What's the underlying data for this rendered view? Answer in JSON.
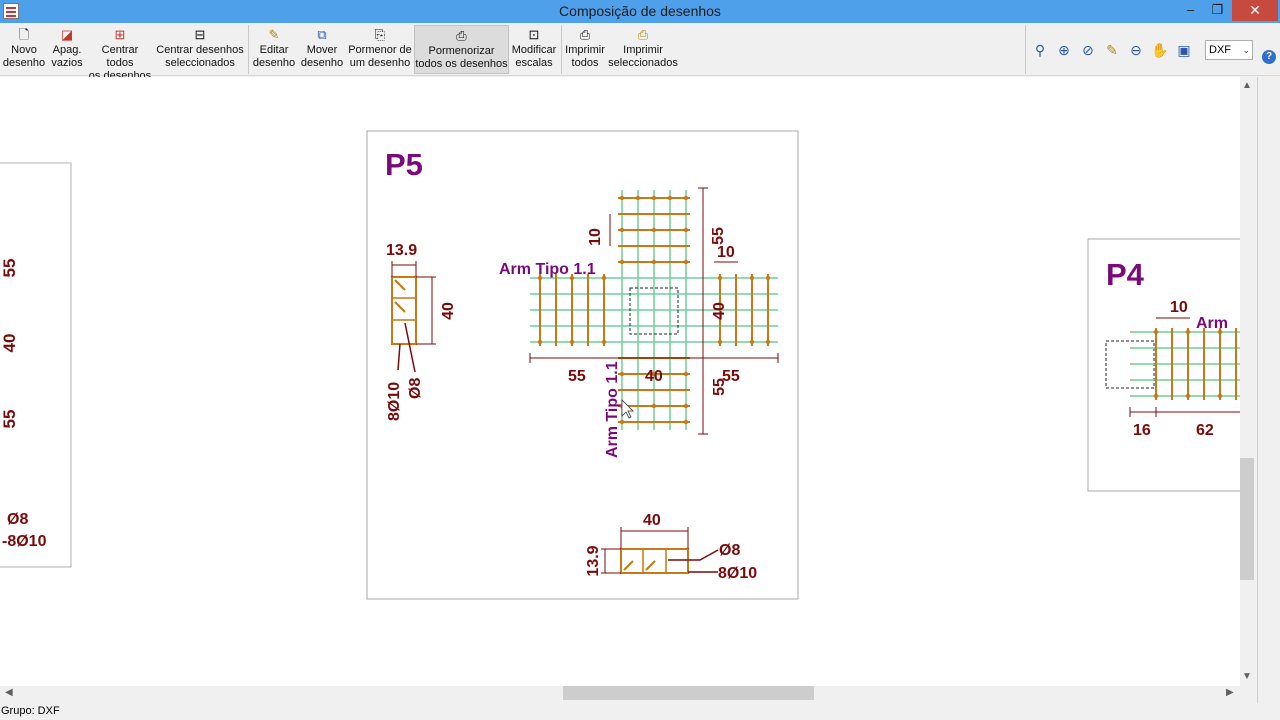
{
  "window": {
    "title": "Composição de desenhos",
    "min": "–",
    "restore": "❐",
    "close": "✕"
  },
  "toolbar": {
    "buttons": [
      {
        "l1": "Novo",
        "l2": "desenho",
        "icon": "new-document-icon"
      },
      {
        "l1": "Apag.",
        "l2": "vazios",
        "icon": "erase-icon"
      },
      {
        "l1": "Centrar todos",
        "l2": "os desenhos",
        "icon": "center-all-icon"
      },
      {
        "l1": "Centrar desenhos",
        "l2": "seleccionados",
        "icon": "center-selected-icon"
      },
      {
        "l1": "Editar",
        "l2": "desenho",
        "icon": "edit-icon"
      },
      {
        "l1": "Mover",
        "l2": "desenho",
        "icon": "move-icon"
      },
      {
        "l1": "Pormenor de",
        "l2": "um desenho",
        "icon": "detail-icon"
      },
      {
        "l1": "Pormenorizar",
        "l2": "todos os desenhos",
        "icon": "detail-all-icon"
      },
      {
        "l1": "Modificar",
        "l2": "escalas",
        "icon": "scale-icon"
      },
      {
        "l1": "Imprimir",
        "l2": "todos",
        "icon": "print-all-icon"
      },
      {
        "l1": "Imprimir",
        "l2": "seleccionados",
        "icon": "print-selected-icon"
      }
    ],
    "format": "DXF"
  },
  "status": {
    "text": "Grupo: DXF"
  },
  "drawings": {
    "left": {
      "d55a": "55",
      "d40": "40",
      "d55b": "55",
      "phi8": "Ø8",
      "phi10": "-8Ø10"
    },
    "p5": {
      "title": "P5",
      "sec_width": "13.9",
      "sec_height": "40",
      "bar_main": "8Ø10",
      "bar_stirrup": "Ø8",
      "arm_h": "Arm Tipo 1.1",
      "arm_v": "Arm Tipo 1.1",
      "d10_top": "10",
      "d55_top": "55",
      "d10_right": "10",
      "d40_mid": "40",
      "d55_left": "55",
      "d40_bottom": "40",
      "d55_right": "55",
      "d55_vbottom": "55",
      "b_width": "40",
      "b_height": "13.9",
      "b_phi8": "Ø8",
      "b_main": "8Ø10"
    },
    "p4": {
      "title": "P4",
      "d10": "10",
      "arm": "Arm",
      "d16": "16",
      "d62": "62"
    }
  },
  "colors": {
    "rebar": "#c87814",
    "stirrup": "#6fcf97",
    "dim": "#7a0a0a",
    "label": "#7a0a7a"
  }
}
